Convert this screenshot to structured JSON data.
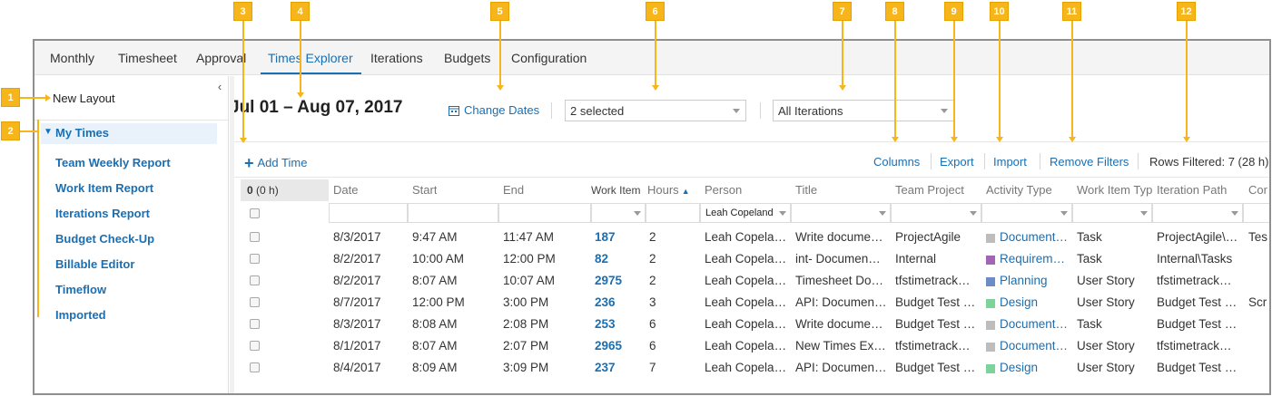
{
  "nav": {
    "tabs": [
      {
        "label": "Monthly"
      },
      {
        "label": "Timesheet"
      },
      {
        "label": "Approval"
      },
      {
        "label": "Times Explorer"
      },
      {
        "label": "Iterations"
      },
      {
        "label": "Budgets"
      },
      {
        "label": "Configuration"
      }
    ],
    "active": "Times Explorer"
  },
  "sidebar": {
    "collapse_icon": "chevron-left-icon",
    "new_layout": "New Layout",
    "my_times": "My Times",
    "reports": [
      "Team Weekly Report",
      "Work Item Report",
      "Iterations Report",
      "Budget Check-Up",
      "Billable Editor",
      "Timeflow",
      "Imported"
    ]
  },
  "header": {
    "date_range": "Jul 01 – Aug 07, 2017",
    "change_dates": "Change Dates",
    "people_filter": "2 selected",
    "iteration_filter": "All Iterations"
  },
  "toolbar": {
    "add_time": "Add Time",
    "columns": "Columns",
    "export": "Export",
    "import": "Import",
    "remove_filters": "Remove Filters",
    "rows_filtered": "Rows Filtered: 7 (28 h)"
  },
  "grid": {
    "count_bold": "0",
    "count_rest": "(0 h)",
    "columns": [
      "Date",
      "Start",
      "End",
      "Work Item",
      "Hours",
      "Person",
      "Title",
      "Team Project",
      "Activity Type",
      "Work Item Typ",
      "Iteration Path",
      "Cor"
    ],
    "person_filter": "Leah Copeland",
    "rows": [
      {
        "date": "8/3/2017",
        "start": "9:47 AM",
        "end": "11:47 AM",
        "work_item": "187",
        "hours": "2",
        "person": "Leah Copela…",
        "title": "Write docume…",
        "team_project": "ProjectAgile",
        "activity": "Document…",
        "activity_color": "#bdbdbd",
        "wi_type": "Task",
        "iteration": "ProjectAgile\\…",
        "cor": "Tes"
      },
      {
        "date": "8/2/2017",
        "start": "10:00 AM",
        "end": "12:00 PM",
        "work_item": "82",
        "hours": "2",
        "person": "Leah Copela…",
        "title": "int- Documen…",
        "team_project": "Internal",
        "activity": "Requirem…",
        "activity_color": "#a265b5",
        "wi_type": "Task",
        "iteration": "Internal\\Tasks",
        "cor": ""
      },
      {
        "date": "8/2/2017",
        "start": "8:07 AM",
        "end": "10:07 AM",
        "work_item": "2975",
        "hours": "2",
        "person": "Leah Copela…",
        "title": "Timesheet Do…",
        "team_project": "tfstimetrack…",
        "activity": "Planning",
        "activity_color": "#6d8cc6",
        "wi_type": "User Story",
        "iteration": "tfstimetrack…",
        "cor": ""
      },
      {
        "date": "8/7/2017",
        "start": "12:00 PM",
        "end": "3:00 PM",
        "work_item": "236",
        "hours": "3",
        "person": "Leah Copela…",
        "title": "API: Documen…",
        "team_project": "Budget Test …",
        "activity": "Design",
        "activity_color": "#7dd39c",
        "wi_type": "User Story",
        "iteration": "Budget Test …",
        "cor": "Scr"
      },
      {
        "date": "8/3/2017",
        "start": "8:08 AM",
        "end": "2:08 PM",
        "work_item": "253",
        "hours": "6",
        "person": "Leah Copela…",
        "title": "Write docume…",
        "team_project": "Budget Test …",
        "activity": "Document…",
        "activity_color": "#bdbdbd",
        "wi_type": "Task",
        "iteration": "Budget Test …",
        "cor": ""
      },
      {
        "date": "8/1/2017",
        "start": "8:07 AM",
        "end": "2:07 PM",
        "work_item": "2965",
        "hours": "6",
        "person": "Leah Copela…",
        "title": "New Times Ex…",
        "team_project": "tfstimetrack…",
        "activity": "Document…",
        "activity_color": "#bdbdbd",
        "wi_type": "User Story",
        "iteration": "tfstimetrack…",
        "cor": ""
      },
      {
        "date": "8/4/2017",
        "start": "8:09 AM",
        "end": "3:09 PM",
        "work_item": "237",
        "hours": "7",
        "person": "Leah Copela…",
        "title": "API: Documen…",
        "team_project": "Budget Test …",
        "activity": "Design",
        "activity_color": "#7dd39c",
        "wi_type": "User Story",
        "iteration": "Budget Test …",
        "cor": ""
      }
    ]
  },
  "callouts": [
    "1",
    "2",
    "3",
    "4",
    "5",
    "6",
    "7",
    "8",
    "9",
    "10",
    "11",
    "12"
  ],
  "colors": {
    "accent": "#1a6fb3",
    "callout": "#f5b51b"
  }
}
